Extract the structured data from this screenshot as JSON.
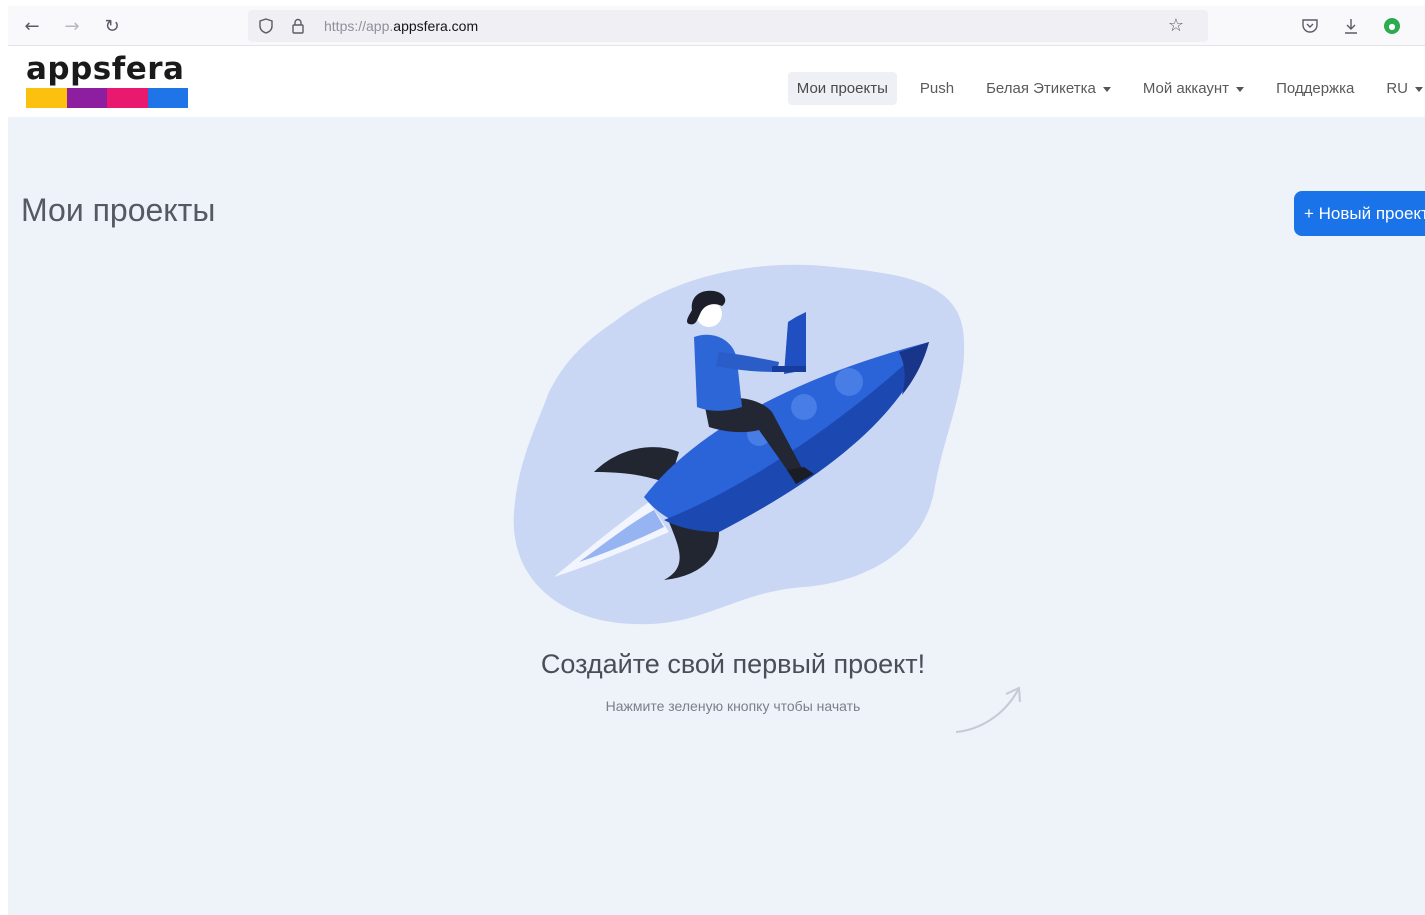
{
  "browser": {
    "url_prefix": "https://app.",
    "url_domain": "appsfera.com",
    "icons": {
      "back": "arrow-left-icon",
      "forward": "arrow-right-icon",
      "reload": "reload-icon",
      "shield": "shield-icon",
      "lock": "lock-icon",
      "bookmark": "star-icon",
      "pocket": "pocket-icon",
      "downloads": "download-icon",
      "extension": "extension-icon"
    }
  },
  "header": {
    "logo_text": "appsfera",
    "logo_colors": [
      "#fcc10f",
      "#8e1ea0",
      "#e8196e",
      "#1f74e8"
    ],
    "nav": {
      "projects": "Мои проекты",
      "push": "Push",
      "white_label": "Белая Этикетка",
      "account": "Мой аккаунт",
      "support": "Поддержка",
      "language": "RU"
    }
  },
  "main": {
    "title": "Мои проекты",
    "new_project_button": "+ Новый проект",
    "empty_title": "Создайте свой первый проект!",
    "empty_hint": "Нажмите зеленую кнопку чтобы начать"
  },
  "colors": {
    "accent": "#1a73e8",
    "page_background": "#eef2f9"
  }
}
